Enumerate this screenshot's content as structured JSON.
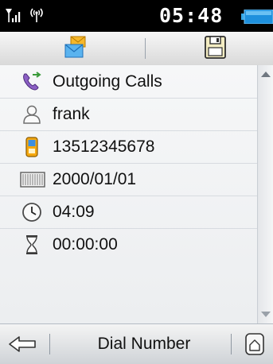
{
  "status": {
    "time": "05:48"
  },
  "details": {
    "call_type": "Outgoing Calls",
    "name": "frank",
    "number": "13512345678",
    "date": "2000/01/01",
    "time": "04:09",
    "duration": "00:00:00"
  },
  "softkeys": {
    "center": "Dial Number"
  },
  "icons": {
    "signal": "signal-strength-icon",
    "antenna": "antenna-icon",
    "battery": "battery-icon",
    "message": "message-icon",
    "save": "save-floppy-icon",
    "call_type": "outgoing-call-icon",
    "name": "person-icon",
    "number": "mobile-phone-icon",
    "date": "calendar-icon",
    "time": "clock-icon",
    "duration": "hourglass-icon",
    "back": "back-arrow-icon",
    "home": "home-icon"
  }
}
